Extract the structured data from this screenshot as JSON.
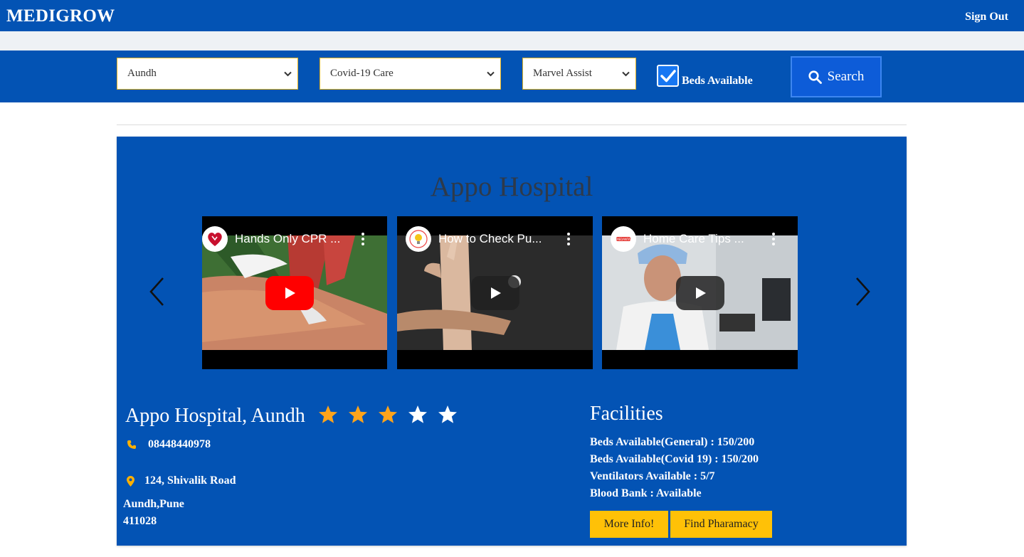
{
  "navbar": {
    "brand": "MEDIGROW",
    "sign_out": "Sign Out"
  },
  "filters": {
    "location": "Aundh",
    "care_type": "Covid-19 Care",
    "assist": "Marvel Assist",
    "beds_checkbox_label": "Beds Available",
    "beds_checked": true,
    "search_label": "Search"
  },
  "card": {
    "title": "Appo Hospital",
    "videos": [
      {
        "title": "Hands Only CPR ...",
        "channel_icon": "heart-logo-icon",
        "play_style": "red"
      },
      {
        "title": "How to Check Pu...",
        "channel_icon": "bulb-logo-icon",
        "play_style": "dark"
      },
      {
        "title": "Home Care Tips ...",
        "channel_icon": "hospital-logo-icon",
        "play_style": "dark"
      }
    ],
    "hospital_name": "Appo Hospital, Aundh",
    "rating": 3,
    "rating_max": 5,
    "phone": "08448440978",
    "address_line1": "124, Shivalik Road",
    "city": "Aundh,Pune",
    "pincode": "411028",
    "facilities_title": "Facilities",
    "facilities": [
      "Beds Available(General) : 150/200",
      "Beds Available(Covid 19) : 150/200",
      "Ventilators Available : 5/7",
      "Blood Bank : Available"
    ],
    "more_info_label": "More Info!",
    "find_pharmacy_label": "Find Pharamacy"
  },
  "colors": {
    "primary": "#0353b4",
    "accent": "#ffc107",
    "star_filled": "#ffa41b",
    "star_empty": "#ffffff"
  }
}
